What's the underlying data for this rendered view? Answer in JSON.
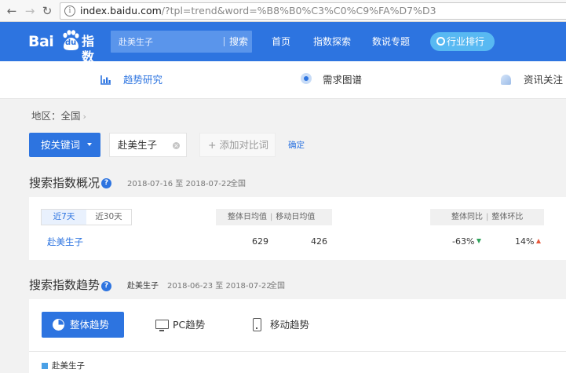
{
  "browser": {
    "url_host": "index.baidu.com",
    "url_rest": "/?tpl=trend&word=%B8%B0%C3%C0%C9%FA%D7%D3",
    "info_glyph": "i"
  },
  "header": {
    "logo_text": "Bai",
    "logo_du": "du",
    "logo_product": "指数",
    "search_value": "赴美生子",
    "search_button": "搜索",
    "nav": [
      "首页",
      "指数探索",
      "数说专题"
    ],
    "rank_button": "行业排行",
    "accent": "#2d74e0"
  },
  "subnav": [
    {
      "label": "趋势研究",
      "icon": "trend-chart-icon",
      "active": true
    },
    {
      "label": "需求图谱",
      "icon": "demand-map-icon",
      "active": false
    },
    {
      "label": "资讯关注",
      "icon": "info-focus-icon",
      "active": false
    }
  ],
  "filters": {
    "region": "地区：全国",
    "region_chevron": "›",
    "keyword_mode": "按关键词",
    "keyword": "赴美生子",
    "clear_glyph": "×",
    "add_compare": "+ 添加对比词",
    "confirm": "确定"
  },
  "overview": {
    "title": "搜索指数概况",
    "help_glyph": "?",
    "date_range": "2018-07-16 至 2018-07-22",
    "region": "全国",
    "tabs": [
      "近7天",
      "近30天"
    ],
    "active_tab": "近7天",
    "avg_headers": [
      "整体日均值",
      "移动日均值"
    ],
    "ratio_headers": [
      "整体同比",
      "整体环比"
    ],
    "header_sep": "|",
    "row": {
      "keyword": "赴美生子",
      "overall_avg": "629",
      "mobile_avg": "426",
      "yoy": "-63%",
      "yoy_direction": "down",
      "mom": "14%",
      "mom_direction": "up"
    },
    "down_color": "#2ea35b",
    "up_color": "#e8593c"
  },
  "trend": {
    "title": "搜索指数趋势",
    "help_glyph": "?",
    "keyword": "赴美生子",
    "date_range": "2018-06-23 至 2018-07-22",
    "region": "全国",
    "tabs": [
      "整体趋势",
      "PC趋势",
      "移动趋势"
    ],
    "active_tab": "整体趋势",
    "legend": "赴美生子",
    "legend_color": "#4aa0e6"
  }
}
